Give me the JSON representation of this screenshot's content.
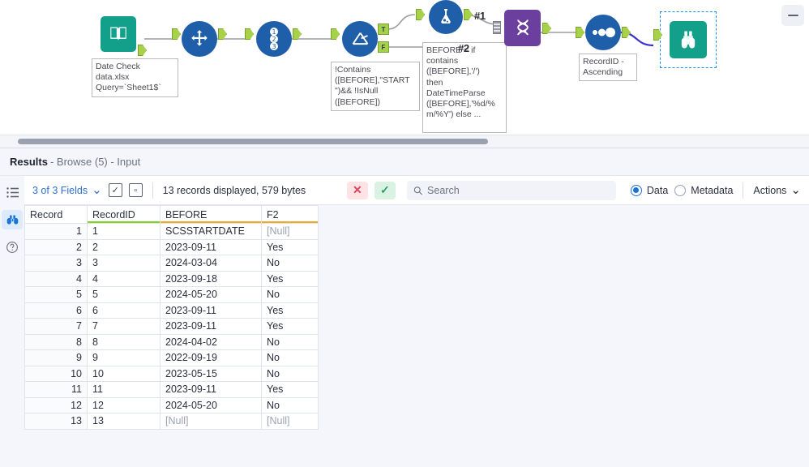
{
  "canvas": {
    "nodes": [
      {
        "id": "input",
        "name": "input-data-tool",
        "icon": "book-icon",
        "annotation": "Date Check\ndata.xlsx\nQuery=`Sheet1$`"
      },
      {
        "id": "select",
        "name": "select-tool",
        "icon": "move-arrows-icon",
        "annotation": ""
      },
      {
        "id": "recordid",
        "name": "record-id-tool",
        "icon": "numbers-123-icon",
        "annotation": ""
      },
      {
        "id": "filter",
        "name": "filter-tool",
        "icon": "filter-funnel-icon",
        "annotation": "!Contains\n([BEFORE],\"START\n\")&& !IsNull\n([BEFORE])"
      },
      {
        "id": "formula",
        "name": "formula-tool",
        "icon": "flask-icon",
        "annotation": ""
      },
      {
        "id": "union",
        "name": "union-tool",
        "icon": "union-helix-icon",
        "annotation": ""
      },
      {
        "id": "sort",
        "name": "sort-tool",
        "icon": "sort-dots-icon",
        "annotation": "RecordID -\nAscending"
      },
      {
        "id": "browse",
        "name": "browse-tool",
        "icon": "binoculars-icon",
        "annotation": ""
      }
    ],
    "formula_annotation": "BEFORE = if\ncontains\n([BEFORE],'/')\nthen\nDateTimeParse\n([BEFORE],'%d/%\nm/%Y') else ...",
    "output_labels": {
      "formula": "#1",
      "union_second": "#2"
    },
    "filter_outputs": {
      "true": "T",
      "false": "F"
    },
    "colors": {
      "tool_blue": "#1f5fa9",
      "tool_teal": "#13a08a",
      "tool_purple": "#6b3f9e",
      "anchor_green": "#a8d14a",
      "selected_link": "#3b2fd4",
      "selection_border": "#1f8cf0"
    }
  },
  "results": {
    "title_main": "Results",
    "title_rest": "- Browse (5) - Input",
    "rail": [
      {
        "name": "list-view-icon",
        "glyph": "☰"
      },
      {
        "name": "binoculars-icon",
        "glyph": "∞"
      },
      {
        "name": "help-icon",
        "glyph": "?"
      }
    ],
    "toolbar": {
      "fields_label": "3 of 3 Fields",
      "chevron": "⌄",
      "select_all_icon": "check-square-icon",
      "clear_icon": "clear-square-icon",
      "record_info": "13 records displayed, 579 bytes",
      "cancel_label": "✕",
      "confirm_label": "✓",
      "search_placeholder": "Search",
      "search_value": "",
      "data_label": "Data",
      "metadata_label": "Metadata",
      "actions_label": "Actions",
      "actions_chevron": "⌄",
      "selected_view": "Data"
    },
    "table": {
      "columns": [
        {
          "label": "Record",
          "underline": "none"
        },
        {
          "label": "RecordID",
          "underline": "#7ed321"
        },
        {
          "label": "BEFORE",
          "underline": "#f5a623"
        },
        {
          "label": "F2",
          "underline": "#f5a623"
        }
      ],
      "rows": [
        {
          "record": "1",
          "recordid": "1",
          "before": "SCSSTARTDATE",
          "f2": "[Null]"
        },
        {
          "record": "2",
          "recordid": "2",
          "before": "2023-09-11",
          "f2": "Yes"
        },
        {
          "record": "3",
          "recordid": "3",
          "before": "2024-03-04",
          "f2": "No"
        },
        {
          "record": "4",
          "recordid": "4",
          "before": "2023-09-18",
          "f2": "Yes"
        },
        {
          "record": "5",
          "recordid": "5",
          "before": "2024-05-20",
          "f2": "No"
        },
        {
          "record": "6",
          "recordid": "6",
          "before": "2023-09-11",
          "f2": "Yes"
        },
        {
          "record": "7",
          "recordid": "7",
          "before": "2023-09-11",
          "f2": "Yes"
        },
        {
          "record": "8",
          "recordid": "8",
          "before": "2024-04-02",
          "f2": "No"
        },
        {
          "record": "9",
          "recordid": "9",
          "before": "2022-09-19",
          "f2": "No"
        },
        {
          "record": "10",
          "recordid": "10",
          "before": "2023-05-15",
          "f2": "No"
        },
        {
          "record": "11",
          "recordid": "11",
          "before": "2023-09-11",
          "f2": "Yes"
        },
        {
          "record": "12",
          "recordid": "12",
          "before": "2024-05-20",
          "f2": "No"
        },
        {
          "record": "13",
          "recordid": "13",
          "before": "[Null]",
          "f2": "[Null]"
        }
      ]
    }
  }
}
